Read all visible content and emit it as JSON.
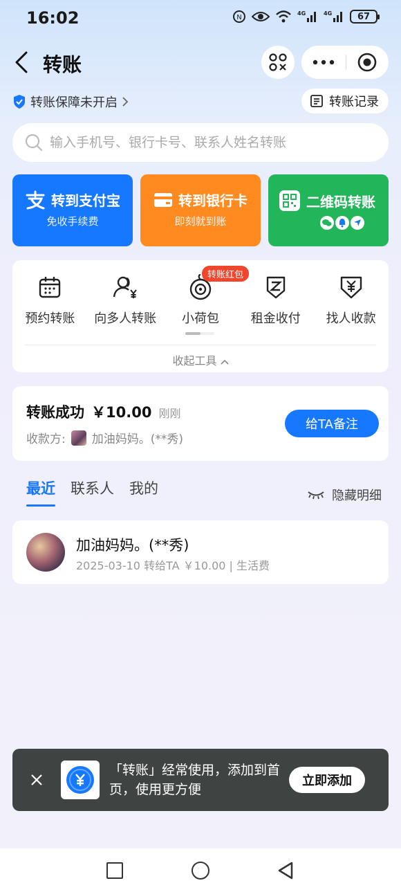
{
  "status_bar": {
    "time": "16:02",
    "battery": "67"
  },
  "header": {
    "title": "转账"
  },
  "protection": {
    "label": "转账保障未开启"
  },
  "records": {
    "label": "转账记录"
  },
  "search": {
    "placeholder": "输入手机号、银行卡号、联系人姓名转账"
  },
  "cards": [
    {
      "label": "转到支付宝",
      "sub": "免收手续费",
      "color": "#1677ff"
    },
    {
      "label": "转到银行卡",
      "sub": "即刻就到账",
      "color": "#ff8a1f"
    },
    {
      "label": "二维码转账",
      "sub": "",
      "color": "#22b55a"
    }
  ],
  "tools": {
    "items": [
      {
        "label": "预约转账",
        "icon": "calendar-icon"
      },
      {
        "label": "向多人转账",
        "icon": "multi-user-yuan-icon"
      },
      {
        "label": "小荷包",
        "icon": "lotus-pouch-icon"
      },
      {
        "label": "租金收付",
        "icon": "rent-icon"
      },
      {
        "label": "找人收款",
        "icon": "yuan-receive-icon"
      }
    ],
    "badge": "转账红包",
    "collapse_label": "收起工具"
  },
  "success": {
    "status": "转账成功",
    "amount": "￥10.00",
    "time": "刚刚",
    "payee_label": "收款方:",
    "payee_name": "加油妈妈。(**秀)",
    "remark_button": "给TA备注"
  },
  "tabs": [
    "最近",
    "联系人",
    "我的"
  ],
  "hide_detail": "隐藏明细",
  "recent": [
    {
      "name": "加油妈妈。(**秀)",
      "meta": "2025-03-10 转给TA ￥10.00 | 生活费"
    }
  ],
  "toast": {
    "message": "「转账」经常使用，添加到首页，使用更方便",
    "button": "立即添加"
  }
}
